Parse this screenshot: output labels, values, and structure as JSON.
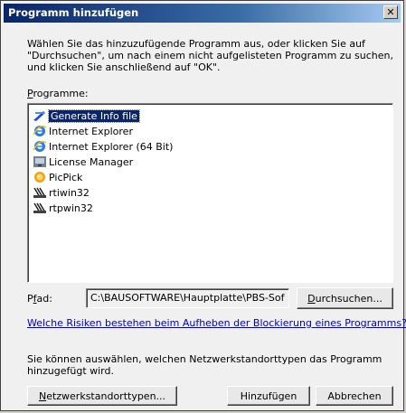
{
  "window": {
    "title": "Programm hinzufügen",
    "close_glyph": "✕"
  },
  "instructions": "Wählen Sie das hinzuzufügende Programm aus, oder klicken Sie auf\n\"Durchsuchen\", um nach einem nicht aufgelisteten Programm zu suchen,\nund klicken Sie anschließend auf \"OK\".",
  "programs_label": "Programme:",
  "programs": [
    {
      "label": "Generate Info file",
      "icon": "generate-info-icon",
      "selected": true
    },
    {
      "label": "Internet Explorer",
      "icon": "internet-explorer-icon",
      "selected": false
    },
    {
      "label": "Internet Explorer (64 Bit)",
      "icon": "internet-explorer-icon",
      "selected": false
    },
    {
      "label": "License Manager",
      "icon": "license-manager-icon",
      "selected": false
    },
    {
      "label": "PicPick",
      "icon": "picpick-icon",
      "selected": false
    },
    {
      "label": "rtiwin32",
      "icon": "rtiwin32-icon",
      "selected": false
    },
    {
      "label": "rtpwin32",
      "icon": "rtpwin32-icon",
      "selected": false
    }
  ],
  "path": {
    "label": "Pfad:",
    "value": "C:\\BAUSOFTWARE\\Hauptplatte\\PBS-Sof"
  },
  "buttons": {
    "browse": "Durchsuchen...",
    "network": "Netzwerkstandorttypen...",
    "add": "Hinzufügen",
    "cancel": "Abbrechen"
  },
  "risk_link": "Welche Risiken bestehen beim Aufheben der Blockierung eines Programms?",
  "network_text": "Sie können auswählen, welchen Netzwerkstandorttypen das Programm\nhinzugefügt wird.",
  "colors": {
    "titlebar_start": "#0a246a",
    "selection": "#0a246a",
    "link": "#0000cc",
    "dialog_bg": "#f0f0f0"
  }
}
